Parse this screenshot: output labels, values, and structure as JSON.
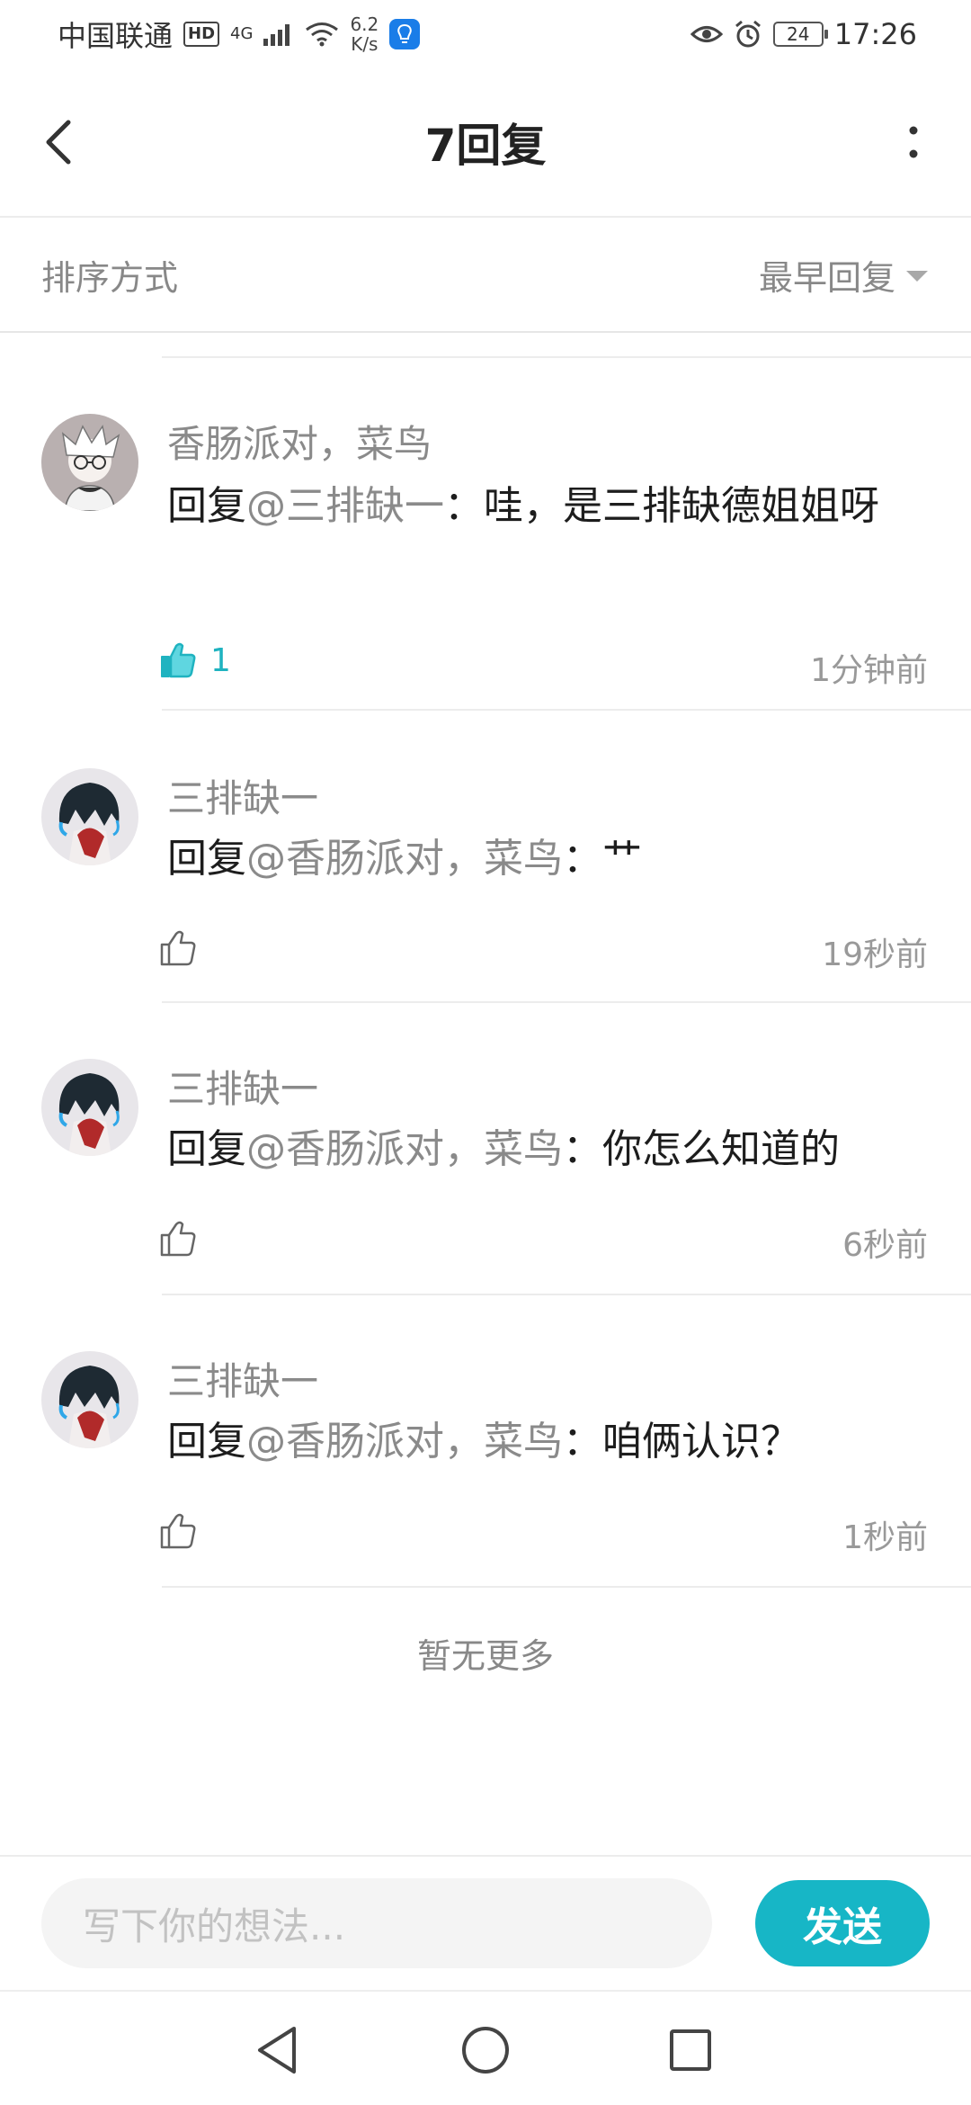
{
  "status_bar": {
    "carrier": "中国联通",
    "hd": "HD",
    "network": "4G",
    "speed_value": "6.2",
    "speed_unit": "K/s",
    "battery": "24",
    "time": "17:26"
  },
  "header": {
    "title": "7回复"
  },
  "sort": {
    "label": "排序方式",
    "selected": "最早回复"
  },
  "replies": [
    {
      "author": "香肠派对，菜鸟",
      "prefix": "回复",
      "mention": "@三排缺一",
      "body": "：哇，是三排缺德姐姐呀",
      "likes": "1",
      "time": "1分钟前",
      "liked": true
    },
    {
      "author": "三排缺一",
      "prefix": "回复",
      "mention": "@香肠派对，菜鸟",
      "body": "：艹",
      "likes": "",
      "time": "19秒前",
      "liked": false
    },
    {
      "author": "三排缺一",
      "prefix": "回复",
      "mention": "@香肠派对，菜鸟",
      "body": "：你怎么知道的",
      "likes": "",
      "time": "6秒前",
      "liked": false
    },
    {
      "author": "三排缺一",
      "prefix": "回复",
      "mention": "@香肠派对，菜鸟",
      "body": "：咱俩认识？",
      "likes": "",
      "time": "1秒前",
      "liked": false
    }
  ],
  "no_more": "暂无更多",
  "composer": {
    "placeholder": "写下你的想法...",
    "send": "发送"
  },
  "colors": {
    "accent": "#17b6c6",
    "mention": "#8a8a8a"
  }
}
